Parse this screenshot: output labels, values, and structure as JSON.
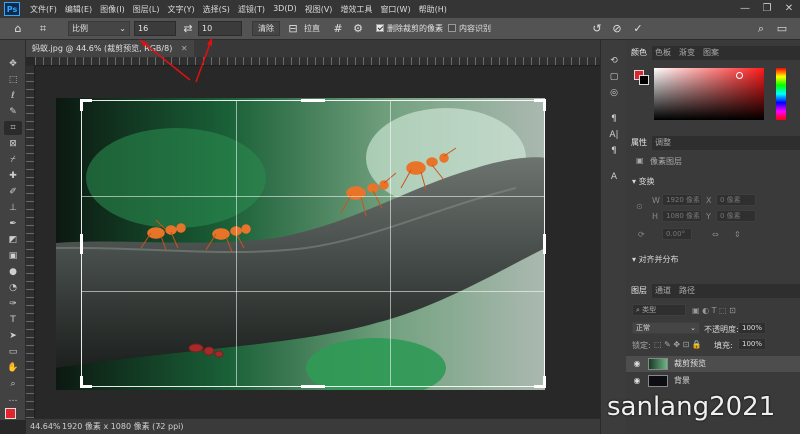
{
  "app": {
    "logo": "Ps"
  },
  "menu": [
    "文件(F)",
    "编辑(E)",
    "图像(I)",
    "图层(L)",
    "文字(Y)",
    "选择(S)",
    "滤镜(T)",
    "3D(D)",
    "视图(V)",
    "增效工具",
    "窗口(W)",
    "帮助(H)"
  ],
  "options": {
    "ratio_select": "比例",
    "width_value": "16",
    "height_value": "10",
    "clear_button": "清除",
    "straighten_label": "拉直",
    "delete_cropped_label": "删除裁剪的像素",
    "delete_cropped_checked": true,
    "content_aware_label": "内容识别",
    "content_aware_checked": false
  },
  "document": {
    "tab_title": "蚂蚁.jpg @ 44.6% (裁剪预览, RGB/8)"
  },
  "status": {
    "zoom": "44.64%",
    "info": "1920 像素 x 1080 像素 (72 ppi)"
  },
  "panels": {
    "color_tabs": [
      "颜色",
      "色板",
      "渐变",
      "图案"
    ],
    "properties_tabs": [
      "属性",
      "调整"
    ],
    "properties_layer_label": "像素图层",
    "transform_label": "变换",
    "w_label": "W",
    "w_value": "1920 像素",
    "h_label": "H",
    "h_value": "1080 像素",
    "x_label": "X",
    "x_value": "0 像素",
    "y_label": "Y",
    "y_value": "0 像素",
    "angle_value": "0.00°",
    "align_label": "对齐并分布",
    "layers_tabs": [
      "图层",
      "通道",
      "路径"
    ],
    "filter_kind": "类型",
    "blend_mode": "正常",
    "opacity_label": "不透明度:",
    "opacity_value": "100%",
    "lock_label": "锁定:",
    "fill_label": "填充:",
    "fill_value": "100%",
    "layers": [
      {
        "name": "裁剪预览"
      },
      {
        "name": "背景"
      }
    ]
  },
  "watermark": "sanlang2021",
  "colors": {
    "foreground": "#e0262c",
    "background": "#000000",
    "annotation_red": "#e01010"
  }
}
